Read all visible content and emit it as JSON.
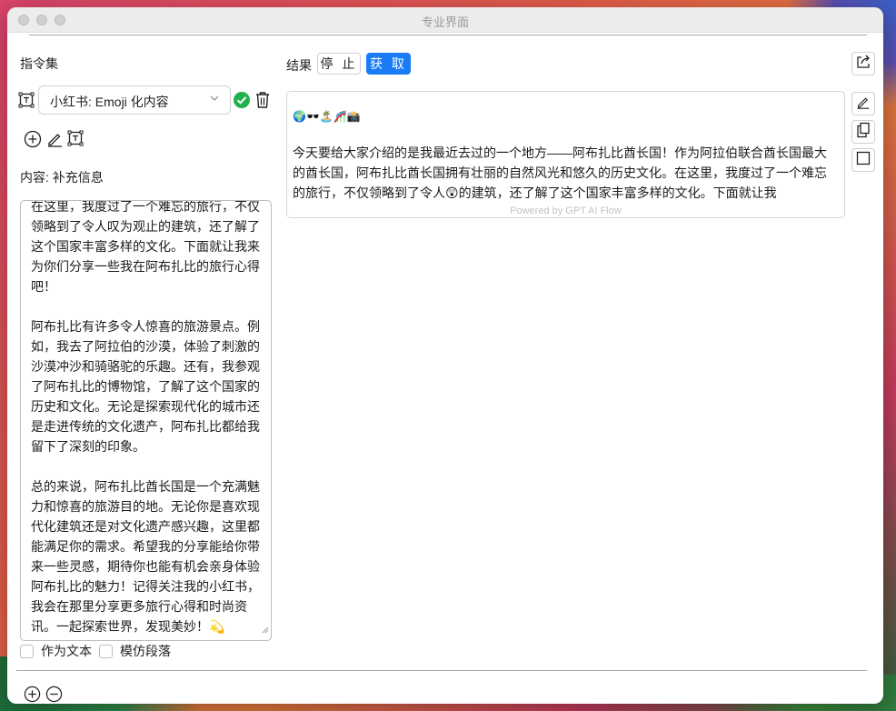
{
  "window": {
    "title": "专业界面"
  },
  "left": {
    "instruction_label": "指令集",
    "select_value": "小红书: Emoji 化内容",
    "content_label": "内容: 补充信息",
    "textarea_value": "在这里，我度过了一个难忘的旅行，不仅领略到了令人叹为观止的建筑，还了解了这个国家丰富多样的文化。下面就让我来为你们分享一些我在阿布扎比的旅行心得吧！\n\n阿布扎比有许多令人惊喜的旅游景点。例如，我去了阿拉伯的沙漠，体验了刺激的沙漠冲沙和骑骆驼的乐趣。还有，我参观了阿布扎比的博物馆，了解了这个国家的历史和文化。无论是探索现代化的城市还是走进传统的文化遗产，阿布扎比都给我留下了深刻的印象。\n\n总的来说，阿布扎比酋长国是一个充满魅力和惊喜的旅游目的地。无论你是喜欢现代化建筑还是对文化遗产感兴趣，这里都能满足你的需求。希望我的分享能给你带来一些灵感，期待你也能有机会亲身体验阿布扎比的魅力！记得关注我的小红书，我会在那里分享更多旅行心得和时尚资讯。一起探索世界，发现美妙！💫",
    "checkbox_text": "作为文本",
    "checkbox_paragraph": "模仿段落"
  },
  "right": {
    "result_label": "结果",
    "stop_label": "停 止",
    "fetch_label": "获 取",
    "result_emoji": "🌍🕶️🏝️🎢📸",
    "result_text": "今天要给大家介绍的是我最近去过的一个地方——阿布扎比酋长国！作为阿拉伯联合酋长国最大的酋长国，阿布扎比酋长国拥有壮丽的自然风光和悠久的历史文化。在这里，我度过了一个难忘的旅行，不仅领略到了令人😲的建筑，还了解了这个国家丰富多样的文化。下面就让我",
    "powered_by": "Powered by GPT AI Flow"
  },
  "colors": {
    "accent": "#1a7cf5",
    "check_green": "#22b14c"
  }
}
